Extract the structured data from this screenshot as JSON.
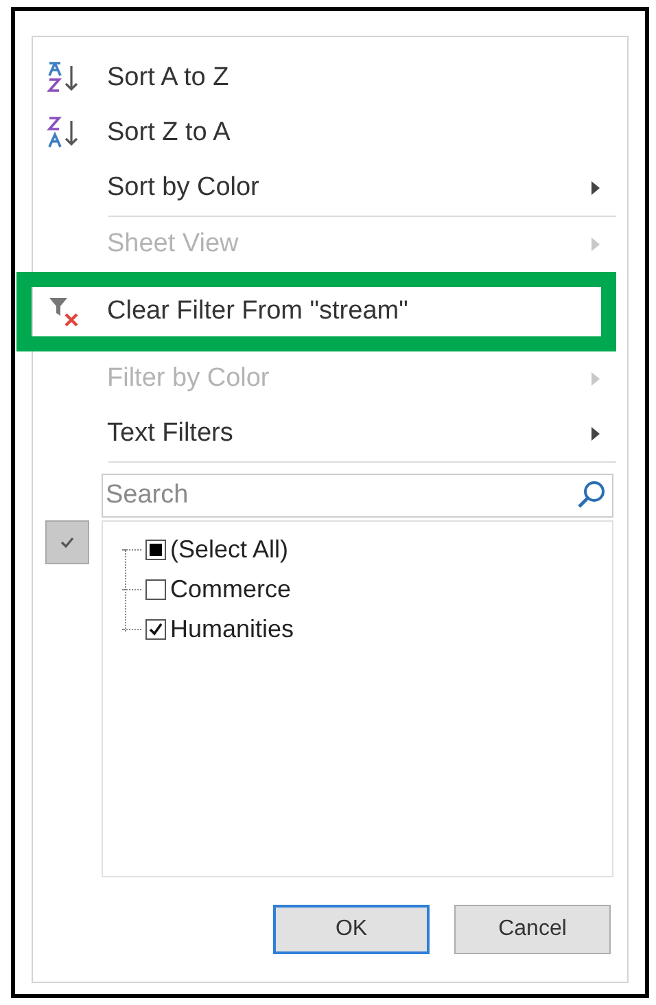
{
  "menu": [
    {
      "label": "Sort A to Z",
      "kind": "sort-asc",
      "disabled": false,
      "submenu": false,
      "highlighted": false,
      "separator_after": false
    },
    {
      "label": "Sort Z to A",
      "kind": "sort-desc",
      "disabled": false,
      "submenu": false,
      "highlighted": false,
      "separator_after": false
    },
    {
      "label": "Sort by Color",
      "kind": "plain",
      "disabled": false,
      "submenu": true,
      "highlighted": false,
      "separator_after": true
    },
    {
      "label": "Sheet View",
      "kind": "plain",
      "disabled": true,
      "submenu": true,
      "highlighted": false,
      "separator_after": false
    },
    {
      "label": "Clear Filter From \"stream\"",
      "kind": "clear-filter",
      "disabled": false,
      "submenu": false,
      "highlighted": true,
      "separator_after": false
    },
    {
      "label": "Filter by Color",
      "kind": "plain",
      "disabled": true,
      "submenu": true,
      "highlighted": false,
      "separator_after": false
    },
    {
      "label": "Text Filters",
      "kind": "plain",
      "disabled": false,
      "submenu": true,
      "highlighted": false,
      "separator_after": true
    }
  ],
  "search": {
    "placeholder": "Search"
  },
  "values": [
    {
      "label": "(Select All)",
      "indeterminate": true
    },
    {
      "label": "Commerce",
      "checked": false
    },
    {
      "label": "Humanities",
      "checked": true
    }
  ],
  "buttons": [
    {
      "label": "OK",
      "default": true
    },
    {
      "label": "Cancel",
      "default": false
    }
  ]
}
